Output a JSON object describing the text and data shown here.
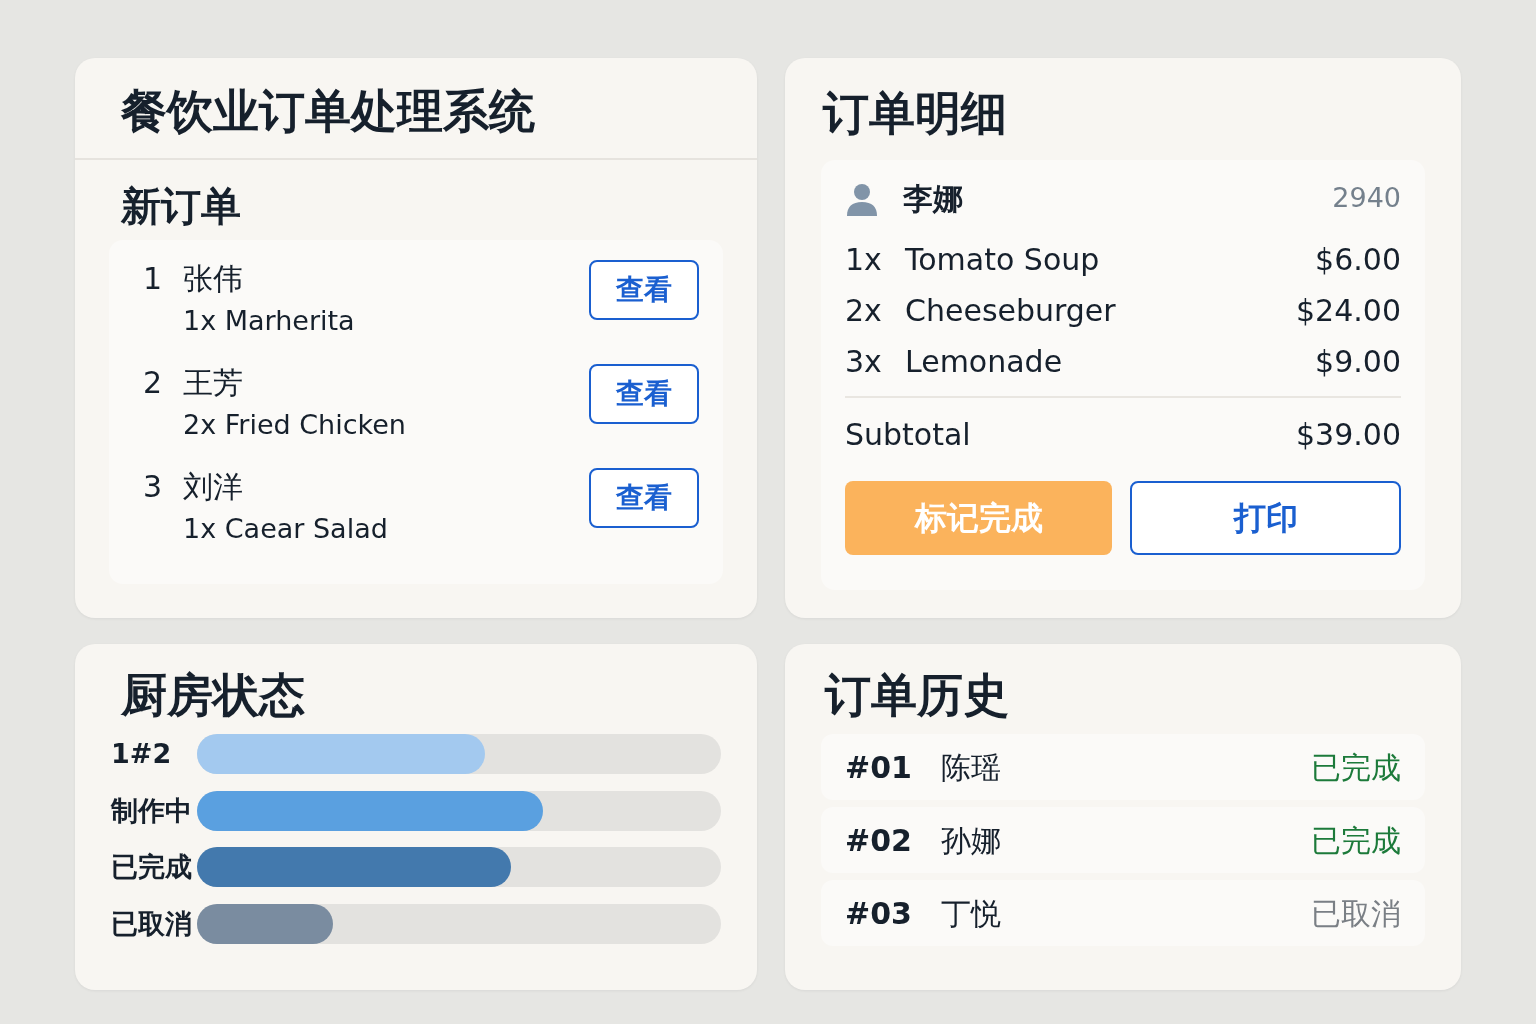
{
  "app_title": "餐饮业订单处理系统",
  "new_orders": {
    "title": "新订单",
    "orders": [
      {
        "number": "1",
        "customer": "张伟",
        "items": "1x Marherita",
        "action": "查看"
      },
      {
        "number": "2",
        "customer": "王芳",
        "items": "2x Fried Chicken",
        "action": "查看"
      },
      {
        "number": "3",
        "customer": "刘洋",
        "items": "1x Caear Salad",
        "action": "查看"
      }
    ]
  },
  "order_detail": {
    "title": "订单明细",
    "customer": "李娜",
    "order_id": "2940",
    "lines": [
      {
        "qty": "1x",
        "item": "Tomato Soup",
        "price": "$6.00"
      },
      {
        "qty": "2x",
        "item": "Cheeseburger",
        "price": "$24.00"
      },
      {
        "qty": "3x",
        "item": "Lemonade",
        "price": "$9.00"
      }
    ],
    "subtotal_label": "Subtotal",
    "subtotal": "$39.00",
    "buttons": [
      {
        "label": "标记完成",
        "kind": "primary"
      },
      {
        "label": "打印",
        "kind": "outline"
      }
    ]
  },
  "kitchen": {
    "title": "厨房状态",
    "bars": [
      {
        "label": "1#2",
        "level": 0.55,
        "color": "#a3c9ef"
      },
      {
        "label": "制作中",
        "level": 0.66,
        "color": "#5aa0e0"
      },
      {
        "label": "已完成",
        "level": 0.6,
        "color": "#4379ad"
      },
      {
        "label": "已取消",
        "level": 0.26,
        "color": "#7a8ca0"
      }
    ]
  },
  "history": {
    "title": "订单历史",
    "rows": [
      {
        "id": "#01",
        "customer": "陈瑶",
        "status": "已完成",
        "kind": "done"
      },
      {
        "id": "#02",
        "customer": "孙娜",
        "status": "已完成",
        "kind": "done"
      },
      {
        "id": "#03",
        "customer": "丁悦",
        "status": "已取消",
        "kind": "cancelled"
      }
    ]
  }
}
